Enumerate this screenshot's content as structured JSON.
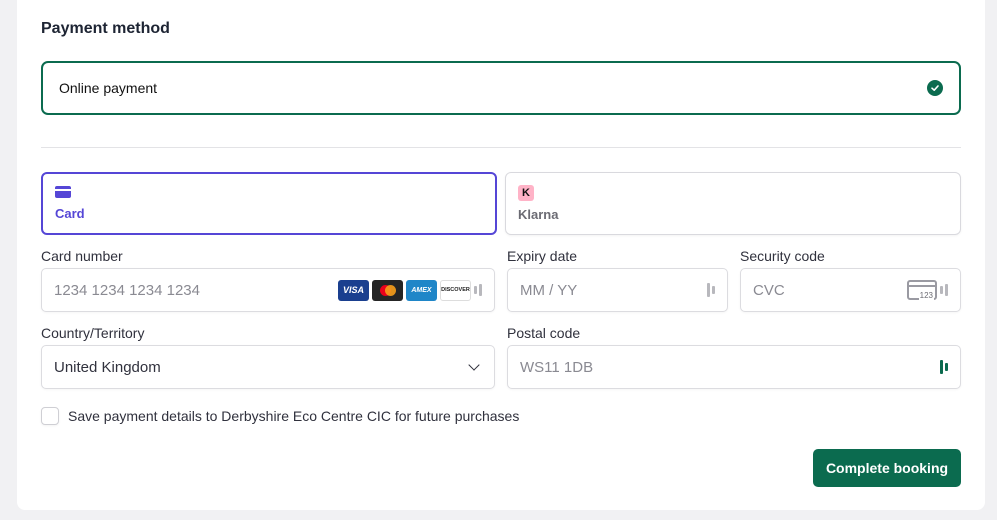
{
  "payment_method": {
    "title": "Payment method",
    "selected_option": "Online payment",
    "selected_icon": "check-circle-icon",
    "accent_color": "#0b6b4f"
  },
  "tabs": [
    {
      "label": "Card",
      "icon": "card-icon",
      "selected": true,
      "color": "#5546d6"
    },
    {
      "label": "Klarna",
      "icon": "klarna-icon",
      "icon_letter": "K",
      "selected": false
    }
  ],
  "card_number": {
    "label": "Card number",
    "placeholder": "1234 1234 1234 1234",
    "brands": [
      "VISA",
      "mastercard",
      "AMEX",
      "DISCOVER"
    ]
  },
  "expiry": {
    "label": "Expiry date",
    "placeholder": "MM / YY"
  },
  "security_code": {
    "label": "Security code",
    "placeholder": "CVC",
    "icon_number": "123"
  },
  "country": {
    "label": "Country/Territory",
    "value": "United Kingdom"
  },
  "postal_code": {
    "label": "Postal code",
    "value": "WS11 1DB"
  },
  "save_details": {
    "label": "Save payment details to Derbyshire Eco Centre CIC for future purchases",
    "checked": false
  },
  "submit": {
    "label": "Complete booking",
    "color": "#0b6b4f"
  }
}
